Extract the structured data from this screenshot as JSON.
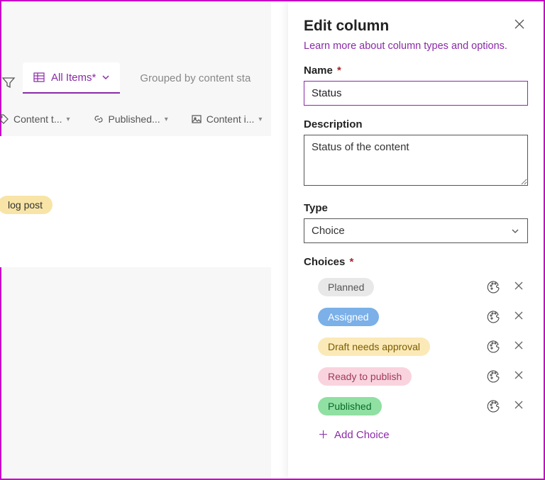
{
  "background": {
    "tab_label": "All Items*",
    "grouped_by": "Grouped by content sta",
    "columns": [
      {
        "label": "Content t...",
        "icon": "tag-icon"
      },
      {
        "label": "Published...",
        "icon": "link-icon"
      },
      {
        "label": "Content i...",
        "icon": "image-icon"
      }
    ],
    "row_pill": "log post"
  },
  "panel": {
    "title": "Edit column",
    "learn_more": "Learn more about column types and options.",
    "name_label": "Name",
    "name_value": "Status",
    "description_label": "Description",
    "description_value": "Status of the content",
    "type_label": "Type",
    "type_value": "Choice",
    "choices_label": "Choices",
    "choices": [
      {
        "label": "Planned",
        "bg": "#e8e8e8",
        "fg": "#555"
      },
      {
        "label": "Assigned",
        "bg": "#7bb0e8",
        "fg": "#fff"
      },
      {
        "label": "Draft needs approval",
        "bg": "#fbe9b7",
        "fg": "#7a5c00"
      },
      {
        "label": "Ready to publish",
        "bg": "#f9d4de",
        "fg": "#a03a5a"
      },
      {
        "label": "Published",
        "bg": "#8fe0a2",
        "fg": "#0a6b2b"
      }
    ],
    "add_choice_label": "Add Choice"
  }
}
